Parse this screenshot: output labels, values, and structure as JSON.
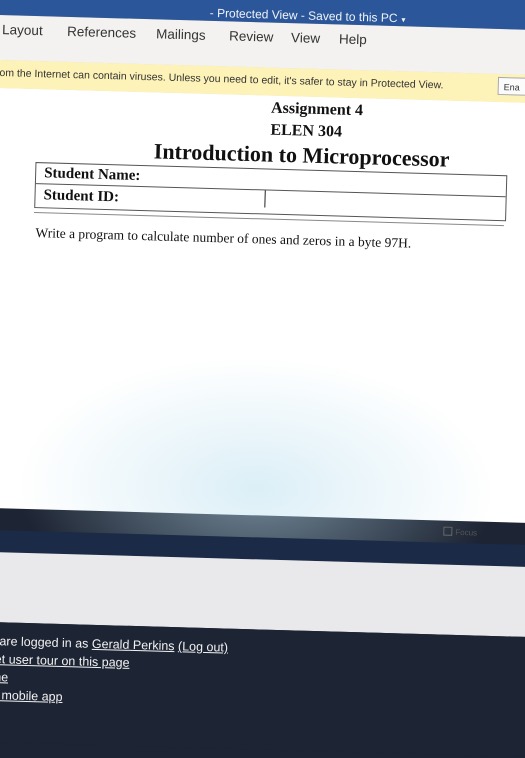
{
  "window": {
    "title_suffix": "- Protected View - Saved to this PC"
  },
  "ribbon": {
    "tabs": [
      "Layout",
      "References",
      "Mailings",
      "Review",
      "View",
      "Help"
    ]
  },
  "protected_view": {
    "message": "rom the Internet can contain viruses. Unless you need to edit, it's safer to stay in Protected View.",
    "enable_button": "Ena"
  },
  "document": {
    "assignment": "Assignment 4",
    "course_code": "ELEN 304",
    "course_title": "Introduction to Microprocessor",
    "student_name_label": "Student Name:",
    "student_id_label": "Student ID:",
    "question": "Write a program to calculate number of ones and zeros in a byte 97H."
  },
  "focus_label": "Focus",
  "footer": {
    "logged_in_prefix": "ou are logged in as",
    "user_name": "Gerald Perkins",
    "logout": "(Log out)",
    "reset_tour": "eset user tour on this page",
    "home": "lome",
    "mobile_app": "the mobile app"
  },
  "colors": {
    "title_bar": "#2b579a",
    "ribbon": "#f3f2f1",
    "protected_bar": "#fdf2b8",
    "footer": "#1d2433"
  }
}
